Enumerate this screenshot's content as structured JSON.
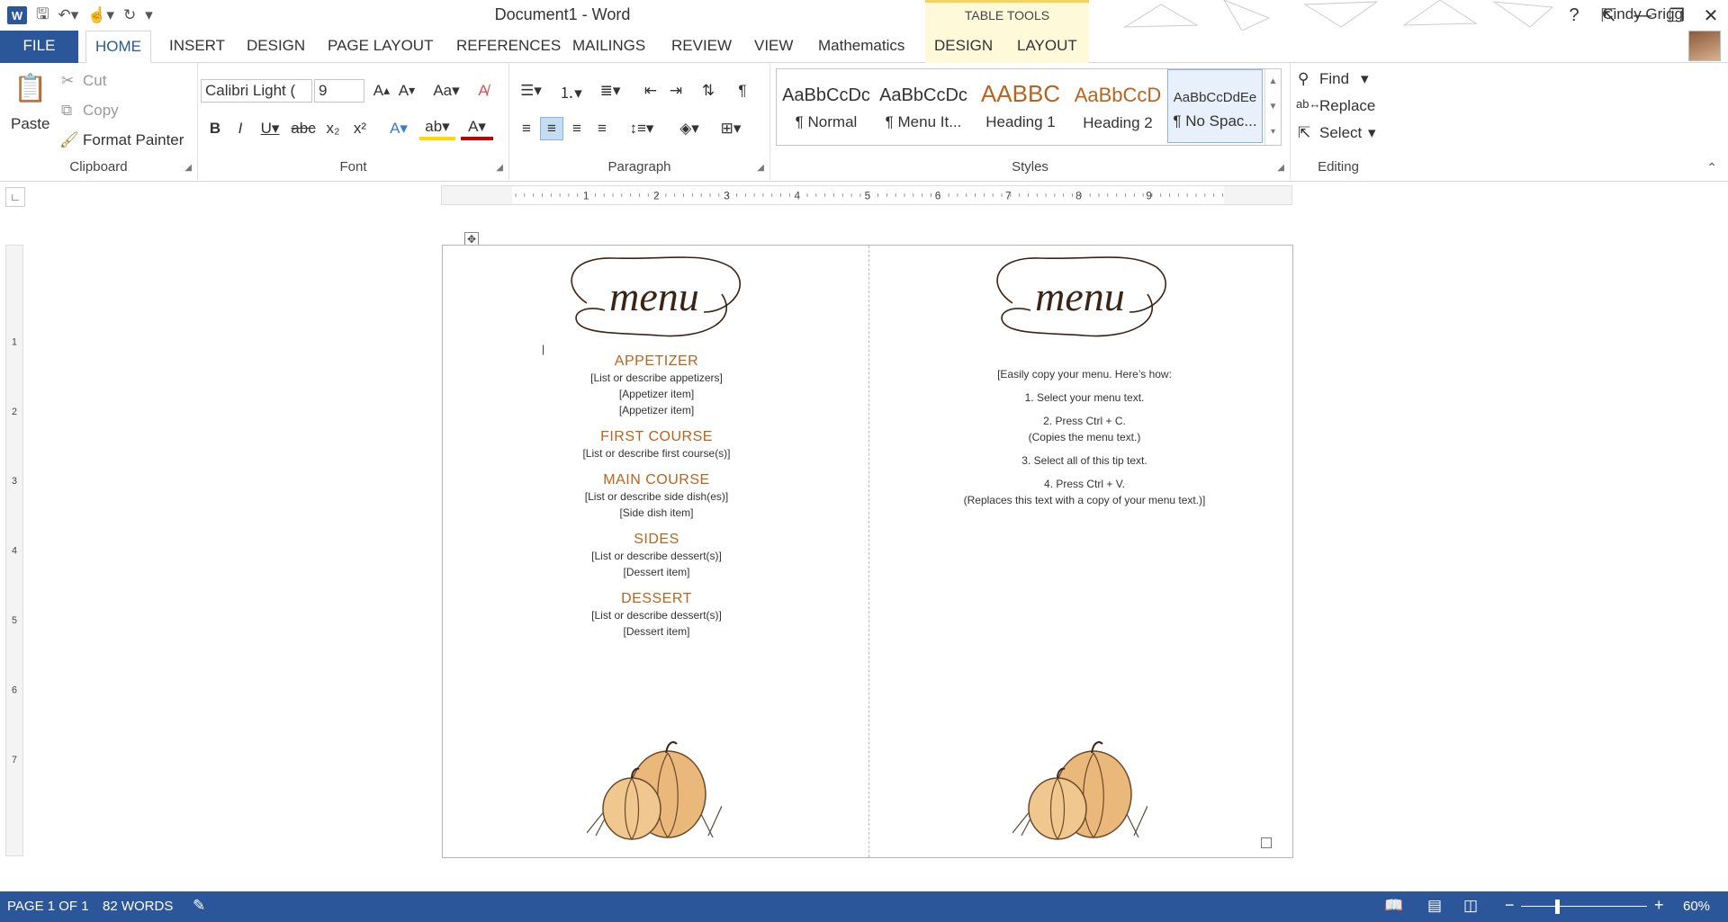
{
  "app": {
    "title": "Document1 - Word",
    "table_tools": "TABLE TOOLS",
    "user": "Cindy Grigg"
  },
  "window_controls": [
    "?",
    "⇱",
    "—",
    "❐",
    "✕"
  ],
  "tabs": [
    "FILE",
    "HOME",
    "INSERT",
    "DESIGN",
    "PAGE LAYOUT",
    "REFERENCES",
    "MAILINGS",
    "REVIEW",
    "VIEW",
    "Mathematics",
    "DESIGN",
    "LAYOUT"
  ],
  "ribbon": {
    "clipboard": {
      "label": "Clipboard",
      "paste": "Paste",
      "cut": "Cut",
      "copy": "Copy",
      "format_painter": "Format Painter"
    },
    "font": {
      "label": "Font",
      "name": "Calibri Light (",
      "size": "9"
    },
    "paragraph": {
      "label": "Paragraph"
    },
    "styles": {
      "label": "Styles",
      "items": [
        {
          "preview": "AaBbCcDc",
          "name": "¶ Normal"
        },
        {
          "preview": "AaBbCcDc",
          "name": "¶ Menu It..."
        },
        {
          "preview": "AABBC",
          "name": "Heading 1"
        },
        {
          "preview": "AaBbCcD",
          "name": "Heading 2"
        },
        {
          "preview": "AaBbCcDdEe",
          "name": "¶ No Spac..."
        }
      ]
    },
    "editing": {
      "label": "Editing",
      "find": "Find",
      "replace": "Replace",
      "select": "Select"
    }
  },
  "ruler_numbers": [
    "1",
    "2",
    "3",
    "4",
    "5",
    "6",
    "7",
    "8",
    "9"
  ],
  "vruler_numbers": [
    "1",
    "2",
    "3",
    "4",
    "5",
    "6",
    "7"
  ],
  "document": {
    "left": {
      "logo": "menu",
      "sections": [
        {
          "heading": "APPETIZER",
          "items": [
            "[List or describe appetizers]",
            "[Appetizer item]",
            "[Appetizer item]"
          ]
        },
        {
          "heading": "FIRST COURSE",
          "items": [
            "[List or describe first course(s)]"
          ]
        },
        {
          "heading": "MAIN COURSE",
          "items": [
            "[List or describe side dish(es)]",
            "[Side dish item]"
          ]
        },
        {
          "heading": "SIDES",
          "items": [
            "[List or describe dessert(s)]",
            "[Dessert item]"
          ]
        },
        {
          "heading": "DESSERT",
          "items": [
            "[List or describe dessert(s)]",
            "[Dessert item]"
          ]
        }
      ]
    },
    "right": {
      "logo": "menu",
      "tips": [
        "[Easily copy your menu. Here’s how:",
        "1. Select your menu text.",
        "2. Press Ctrl + C.",
        "(Copies the menu text.)",
        "3. Select all of this tip text.",
        "4. Press Ctrl + V.",
        "(Replaces this text with a copy of your menu text.)]"
      ]
    }
  },
  "status": {
    "page": "PAGE 1 OF 1",
    "words": "82 WORDS",
    "zoom": "60%"
  },
  "colors": {
    "accent": "#2b579a",
    "heading": "#b5651d",
    "table_tools_bg": "#fef9d9"
  }
}
